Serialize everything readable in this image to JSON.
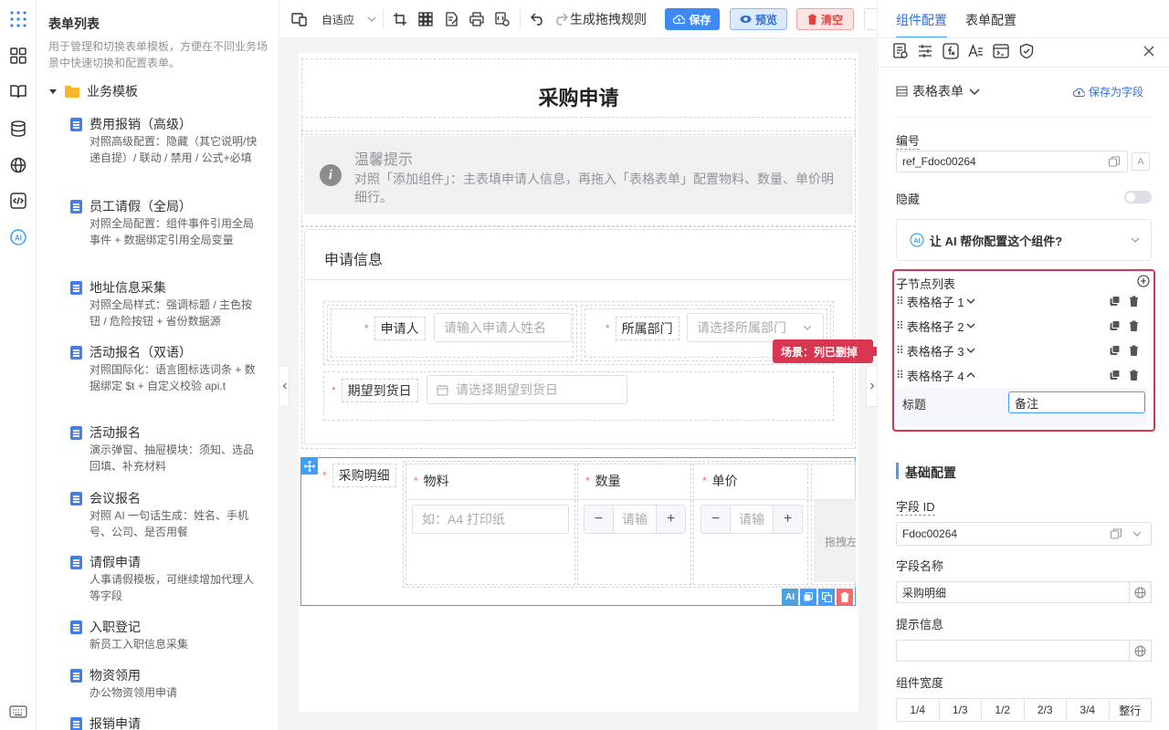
{
  "left_panel": {
    "title": "表单列表",
    "description": "用于管理和切换表单模板，方便在不同业务场景中快速切换和配置表单。",
    "group": "业务模板",
    "templates": [
      {
        "title": "费用报销（高级）",
        "desc": "对照高级配置：隐藏（其它说明/快递自提）/ 联动 / 禁用 / 公式+必填"
      },
      {
        "title": "员工请假（全局）",
        "desc": "对照全局配置：组件事件引用全局事件 + 数据绑定引用全局变量"
      },
      {
        "title": "地址信息采集",
        "desc": "对照全局样式：强调标题 / 主色按钮 / 危险按钮 + 省份数据源"
      },
      {
        "title": "活动报名（双语）",
        "desc": "对照国际化：语言图标选词条 + 数据绑定 $t + 自定义校验 api.t"
      },
      {
        "title": "活动报名",
        "desc": "演示弹窗、抽屉模块：须知、选品回填、补充材料"
      },
      {
        "title": "会议报名",
        "desc": "对照 AI 一句话生成：姓名、手机号、公司、是否用餐"
      },
      {
        "title": "请假申请",
        "desc": "人事请假模板，可继续增加代理人等字段"
      },
      {
        "title": "入职登记",
        "desc": "新员工入职信息采集"
      },
      {
        "title": "物资领用",
        "desc": "办公物资领用申请"
      },
      {
        "title": "报销申请",
        "desc": ""
      }
    ]
  },
  "toolbar": {
    "adapt": "自适应",
    "gen_rules": "生成拖拽规则",
    "save": "保存",
    "preview": "预览",
    "clear": "清空"
  },
  "form": {
    "title": "采购申请",
    "tip_title": "温馨提示",
    "tip_text": "对照「添加组件」：主表填申请人信息，再拖入「表格表单」配置物料、数量、单价明细行。",
    "section_title": "申请信息",
    "applicant_label": "申请人",
    "applicant_placeholder": "请输入申请人姓名",
    "dept_label": "所属部门",
    "dept_placeholder": "请选择所属部门",
    "date_label": "期望到货日",
    "date_placeholder": "请选择期望到货日",
    "detail_label": "采购明细",
    "col_material": "物料",
    "col_qty": "数量",
    "col_price": "单价",
    "material_placeholder": "如：A4 打印纸",
    "qty_placeholder": "请输",
    "price_placeholder": "请输",
    "drag_hint": "拖拽左"
  },
  "annotation": "场景：列已删掉",
  "right_panel": {
    "tab_component": "组件配置",
    "tab_form": "表单配置",
    "component_type": "表格表单",
    "save_as_field": "保存为字段",
    "number_label": "编号",
    "number_value": "ref_Fdoc00264",
    "hidden_label": "隐藏",
    "ai_text": "让 AI 帮你配置这个组件?",
    "children_title": "子节点列表",
    "children": [
      "表格格子 1",
      "表格格子 2",
      "表格格子 3",
      "表格格子 4"
    ],
    "child_title_label": "标题",
    "child_title_value": "备注",
    "basic_title": "基础配置",
    "field_id_label": "字段 ID",
    "field_id_value": "Fdoc00264",
    "field_name_label": "字段名称",
    "field_name_value": "采购明细",
    "hint_label": "提示信息",
    "width_label": "组件宽度",
    "width_options": [
      "1/4",
      "1/3",
      "1/2",
      "2/3",
      "3/4",
      "整行"
    ]
  }
}
